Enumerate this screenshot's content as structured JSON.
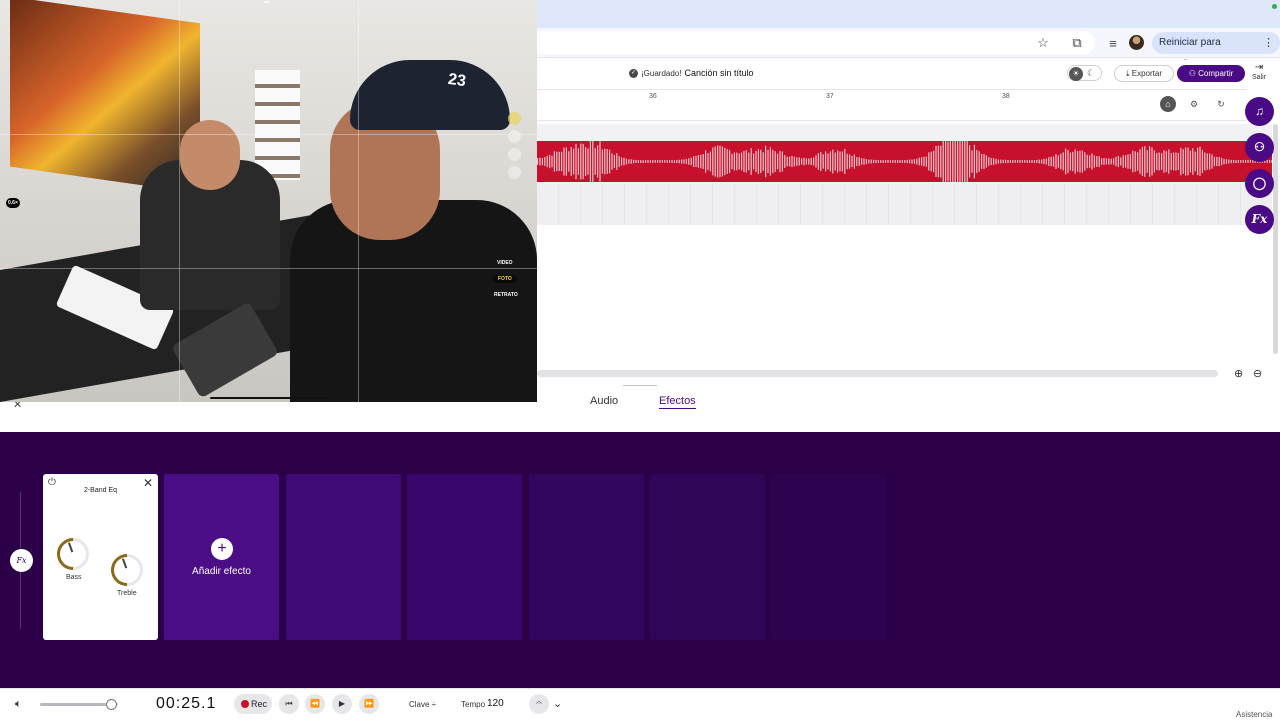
{
  "browser": {
    "restart_label": "Reiniciar para actualizar",
    "restart_menu": "⋮",
    "icons": [
      "star-icon",
      "lens-icon",
      "playlist-icon",
      "avatar"
    ]
  },
  "header": {
    "saved_label": "¡Guardado!",
    "song_title": "Canción sin título",
    "export_label": "Exportar",
    "share_label": "Compartir",
    "exit_label": "Salir"
  },
  "timeline": {
    "ticks": [
      "36",
      "37",
      "38"
    ],
    "track_color": "#c6102c"
  },
  "tabs": {
    "audio": "Audio",
    "effects": "Efectos"
  },
  "fab": {
    "fx_label": "Fx"
  },
  "effects": {
    "fx_badge": "Fx",
    "eq_title": "2-Band Eq",
    "bass_label": "Bass",
    "treble_label": "Treble",
    "add_label": "Añadir efecto",
    "add_symbol": "+"
  },
  "transport": {
    "volume_level": 0.85,
    "time": "00:25.1",
    "rec_label": "Rec",
    "clave_label": "Clave",
    "tempo_label": "Tempo",
    "tempo_value": "120"
  },
  "footer": {
    "assist_label": "Asistencia"
  },
  "camera": {
    "zoom_label": "0.6×",
    "modes": [
      "VIDEO",
      "FOTO",
      "RETRATO"
    ],
    "active_mode": "FOTO",
    "cap_number": "23",
    "top_dots": "•••"
  },
  "colors": {
    "brand": "#4b0a85",
    "panel": "#2b0049",
    "record": "#c6102c"
  }
}
